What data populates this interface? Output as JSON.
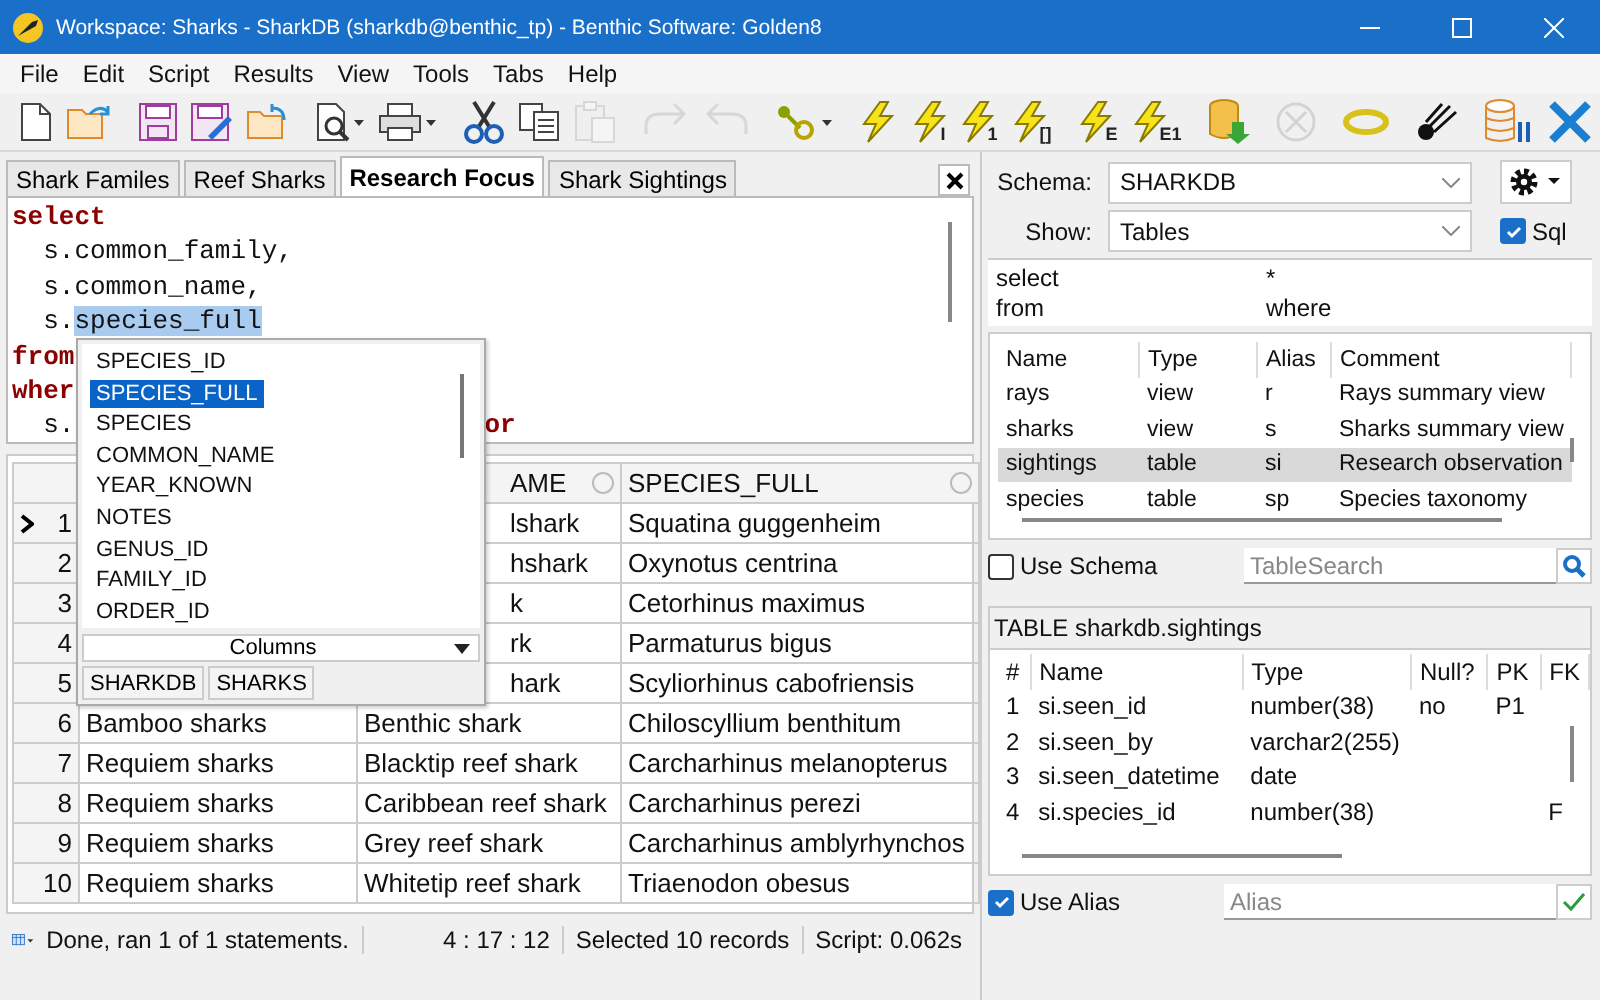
{
  "window": {
    "title": "Workspace: Sharks - SharkDB (sharkdb@benthic_tp) - Benthic Software: Golden8"
  },
  "menu": [
    "File",
    "Edit",
    "Script",
    "Results",
    "View",
    "Tools",
    "Tabs",
    "Help"
  ],
  "toolbar": [
    {
      "kind": "new",
      "disabled": false
    },
    {
      "kind": "open",
      "disabled": false
    },
    {
      "kind": "sep"
    },
    {
      "kind": "save",
      "disabled": false
    },
    {
      "kind": "saveas",
      "disabled": false
    },
    {
      "kind": "revert",
      "disabled": false
    },
    {
      "kind": "sep"
    },
    {
      "kind": "preview",
      "disabled": false
    },
    {
      "kind": "print",
      "disabled": false
    },
    {
      "kind": "sep"
    },
    {
      "kind": "cut",
      "disabled": false
    },
    {
      "kind": "copy",
      "disabled": false
    },
    {
      "kind": "paste",
      "disabled": true
    },
    {
      "kind": "sep"
    },
    {
      "kind": "redo",
      "disabled": true
    },
    {
      "kind": "undo",
      "disabled": true
    },
    {
      "kind": "sep"
    },
    {
      "kind": "format",
      "disabled": false
    },
    {
      "kind": "sep"
    },
    {
      "kind": "run",
      "disabled": false
    },
    {
      "kind": "run",
      "sub": "I",
      "disabled": false
    },
    {
      "kind": "run",
      "sub": "1",
      "disabled": false
    },
    {
      "kind": "run",
      "sub": "[]",
      "disabled": false
    },
    {
      "kind": "sep"
    },
    {
      "kind": "run",
      "sub": "E",
      "disabled": false
    },
    {
      "kind": "run",
      "sub": "E1",
      "disabled": false
    },
    {
      "kind": "sep"
    },
    {
      "kind": "export",
      "disabled": false
    },
    {
      "kind": "sep"
    },
    {
      "kind": "cancel",
      "disabled": true
    },
    {
      "kind": "sep"
    },
    {
      "kind": "ring",
      "disabled": false
    },
    {
      "kind": "sep"
    },
    {
      "kind": "comet",
      "disabled": false
    },
    {
      "kind": "sep"
    },
    {
      "kind": "dbsettings",
      "disabled": false
    },
    {
      "kind": "tools",
      "disabled": false
    }
  ],
  "editor_tabs": [
    {
      "label": "Shark Familes",
      "selected": false
    },
    {
      "label": "Reef Sharks",
      "selected": false
    },
    {
      "label": "Research Focus",
      "selected": true
    },
    {
      "label": "Shark Sightings",
      "selected": false
    }
  ],
  "editor": {
    "lines": [
      [
        {
          "text": "select",
          "kind": "keyword"
        }
      ],
      [
        {
          "text": "  s.common_family,",
          "kind": "plain"
        }
      ],
      [
        {
          "text": "  s.common_name,",
          "kind": "plain"
        }
      ],
      [
        {
          "text": "  s.",
          "kind": "plain"
        },
        {
          "text": "species_full",
          "kind": "selected"
        }
      ],
      [
        {
          "text": "from",
          "kind": "keyword"
        }
      ],
      [
        {
          "text": "wher",
          "kind": "keyword"
        }
      ],
      [
        {
          "text": "  s.",
          "kind": "plain"
        },
        {
          "text": "or",
          "kind": "keyword"
        }
      ]
    ]
  },
  "autocomplete": {
    "items": [
      {
        "label": "SPECIES_ID",
        "selected": false
      },
      {
        "label": "SPECIES_FULL",
        "selected": true
      },
      {
        "label": "SPECIES",
        "selected": false
      },
      {
        "label": "COMMON_NAME",
        "selected": false
      },
      {
        "label": "YEAR_KNOWN",
        "selected": false
      },
      {
        "label": "NOTES",
        "selected": false
      },
      {
        "label": "GENUS_ID",
        "selected": false
      },
      {
        "label": "FAMILY_ID",
        "selected": false
      },
      {
        "label": "ORDER_ID",
        "selected": false
      }
    ],
    "dropdown": "Columns",
    "tabs": [
      "SHARKDB",
      "SHARKS"
    ]
  },
  "results": {
    "columns": [
      "AME",
      "SPECIES_FULL"
    ],
    "rows": [
      {
        "number": "1",
        "current": true,
        "common_name": "lshark",
        "species_full": "Squatina guggenheim"
      },
      {
        "number": "2",
        "current": false,
        "common_name": "hshark",
        "species_full": "Oxynotus centrina"
      },
      {
        "number": "3",
        "current": false,
        "common_name": "k",
        "species_full": "Cetorhinus maximus"
      },
      {
        "number": "4",
        "current": false,
        "common_name": "rk",
        "species_full": "Parmaturus bigus"
      },
      {
        "number": "5",
        "current": false,
        "common_name": "hark",
        "species_full": "Scyliorhinus cabofriensis"
      },
      {
        "number": "6",
        "current": false,
        "family": "Bamboo sharks",
        "common_name": "Benthic shark",
        "species_full": "Chiloscyllium benthitum"
      },
      {
        "number": "7",
        "current": false,
        "family": "Requiem sharks",
        "common_name": "Blacktip reef shark",
        "species_full": "Carcharhinus melanopterus"
      },
      {
        "number": "8",
        "current": false,
        "family": "Requiem sharks",
        "common_name": "Caribbean reef shark",
        "species_full": "Carcharhinus perezi"
      },
      {
        "number": "9",
        "current": false,
        "family": "Requiem sharks",
        "common_name": "Grey reef shark",
        "species_full": "Carcharhinus amblyrhynchos"
      },
      {
        "number": "10",
        "current": false,
        "family": "Requiem sharks",
        "common_name": "Whitetip reef shark",
        "species_full": "Triaenodon obesus"
      }
    ]
  },
  "status_bar": {
    "message": "Done, ran 1 of 1 statements.",
    "position": "4 : 17 : 12",
    "selection": "Selected 10 records",
    "timing": "Script: 0.062s"
  },
  "object_browser": {
    "schema_label": "Schema:",
    "schema": "SHARKDB",
    "show_label": "Show:",
    "show": "Tables",
    "sql": {
      "label": "Sql",
      "checked": true
    },
    "sql_grid": [
      [
        "select",
        "*"
      ],
      [
        "from",
        "where"
      ]
    ],
    "objects": {
      "columns": [
        "Name",
        "Type",
        "Alias",
        "Comment"
      ],
      "rows": [
        {
          "name": "rays",
          "type": "view",
          "alias": "r",
          "comment": "Rays summary view",
          "selected": false
        },
        {
          "name": "sharks",
          "type": "view",
          "alias": "s",
          "comment": "Sharks summary view",
          "selected": false
        },
        {
          "name": "sightings",
          "type": "table",
          "alias": "si",
          "comment": "Research observation",
          "selected": true
        },
        {
          "name": "species",
          "type": "table",
          "alias": "sp",
          "comment": "Species taxonomy",
          "selected": false
        }
      ]
    },
    "use_schema": {
      "label": "Use Schema",
      "checked": false
    },
    "search": {
      "placeholder": "TableSearch"
    }
  },
  "table_detail": {
    "title": "TABLE sharkdb.sightings",
    "columns": [
      "#",
      "Name",
      "Type",
      "Null?",
      "PK",
      "FK"
    ],
    "rows": [
      {
        "num": "1",
        "name": "si.seen_id",
        "type": "number(38)",
        "nullable": "no",
        "pk": "P1"
      },
      {
        "num": "2",
        "name": "si.seen_by",
        "type": "varchar2(255)"
      },
      {
        "num": "3",
        "name": "si.seen_datetime",
        "type": "date"
      },
      {
        "num": "4",
        "name": "si.species_id",
        "type": "number(38)",
        "fk": "F"
      }
    ],
    "use_alias": {
      "label": "Use Alias",
      "checked": true
    },
    "alias": {
      "placeholder": "Alias"
    }
  }
}
